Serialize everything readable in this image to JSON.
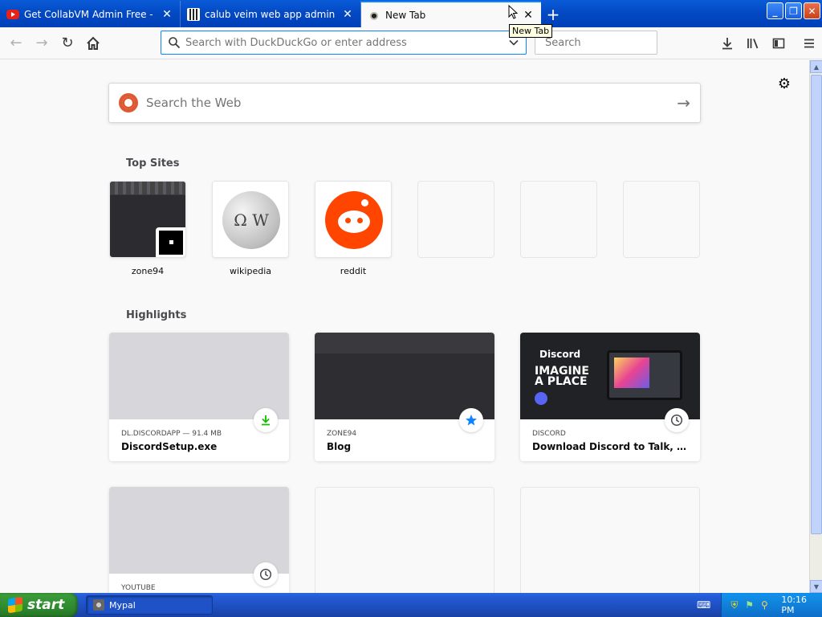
{
  "tabs": [
    {
      "title": "Get CollabVM Admin Free - YouTube",
      "icon": "youtube-icon",
      "active": false
    },
    {
      "title": "calub veim web app admin exploit",
      "icon": "site-icon",
      "active": false
    },
    {
      "title": "New Tab",
      "icon": "mypal-icon",
      "active": true
    }
  ],
  "tooltip": "New Tab",
  "urlbar": {
    "placeholder": "Search with DuckDuckGo or enter address"
  },
  "searchbar": {
    "placeholder": "Search"
  },
  "websearch": {
    "placeholder": "Search the Web"
  },
  "top_sites": {
    "title": "Top Sites",
    "items": [
      {
        "label": "zone94"
      },
      {
        "label": "wikipedia"
      },
      {
        "label": "reddit"
      }
    ]
  },
  "highlights": {
    "title": "Highlights",
    "cards": [
      {
        "meta": "DL.DISCORDAPP — 91.4 MB",
        "title": "DiscordSetup.exe",
        "badge": "download-icon"
      },
      {
        "meta": "ZONE94",
        "title": "Blog",
        "badge": "bookmark-star-icon"
      },
      {
        "meta": "DISCORD",
        "title": "Download Discord to Talk, Chat, ...",
        "badge": "history-clock-icon",
        "image_text": [
          "Discord",
          "IMAGINE",
          "A PLACE"
        ]
      },
      {
        "meta": "YOUTUBE",
        "title": "",
        "badge": "history-clock-icon"
      }
    ]
  },
  "taskbar": {
    "start_label": "start",
    "tasks": [
      {
        "label": "Mypal"
      }
    ],
    "clock": "10:16 PM"
  },
  "colors": {
    "accent": "#0a84ff",
    "xp_blue": "#245edb",
    "start_green": "#3c9e3c",
    "reddit": "#ff4500",
    "discord_bg": "#202225"
  }
}
